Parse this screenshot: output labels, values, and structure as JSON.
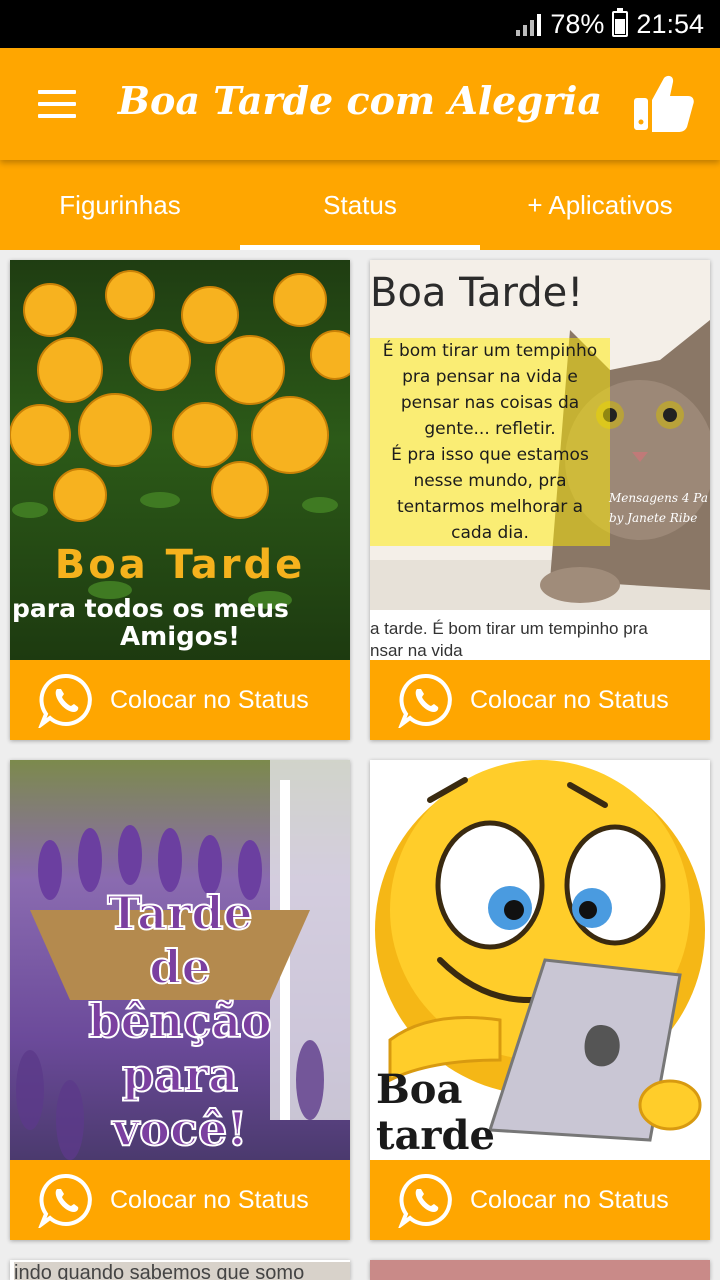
{
  "status_bar": {
    "battery": "78%",
    "time": "21:54"
  },
  "app_bar": {
    "title": "Boa Tarde com Alegria"
  },
  "tabs": [
    {
      "label": "Figurinhas"
    },
    {
      "label": "Status"
    },
    {
      "label": "+ Aplicativos"
    }
  ],
  "cards": [
    {
      "image_text": {
        "line1": "Boa Tarde",
        "line2": "para todos os meus",
        "line3": "Amigos!"
      },
      "button_label": "Colocar no Status"
    },
    {
      "image_text": {
        "heading": "Boa Tarde!",
        "body": [
          "É bom tirar um tempinho",
          "pra pensar na vida e",
          "pensar nas coisas da",
          "gente... refletir.",
          "É pra isso que estamos",
          "nesse mundo, pra",
          "tentarmos melhorar a",
          "cada dia."
        ],
        "signature": [
          "Mensagens 4 Pa",
          "by Janete Ribe"
        ],
        "caption": [
          "a tarde. É bom tirar um tempinho pra",
          "nsar na vida"
        ]
      },
      "button_label": "Colocar no Status"
    },
    {
      "image_text": {
        "lines": [
          "Tarde",
          "de",
          "bênção",
          "para",
          "você!"
        ]
      },
      "button_label": "Colocar no Status"
    },
    {
      "image_text": {
        "line1": "Boa",
        "line2": "tarde"
      },
      "button_label": "Colocar no Status"
    },
    {
      "image_text": {
        "partial": "indo quando sabemos que somo"
      }
    }
  ],
  "colors": {
    "accent": "#ffa600",
    "status_bar": "#000000",
    "background": "#eeeeee"
  }
}
